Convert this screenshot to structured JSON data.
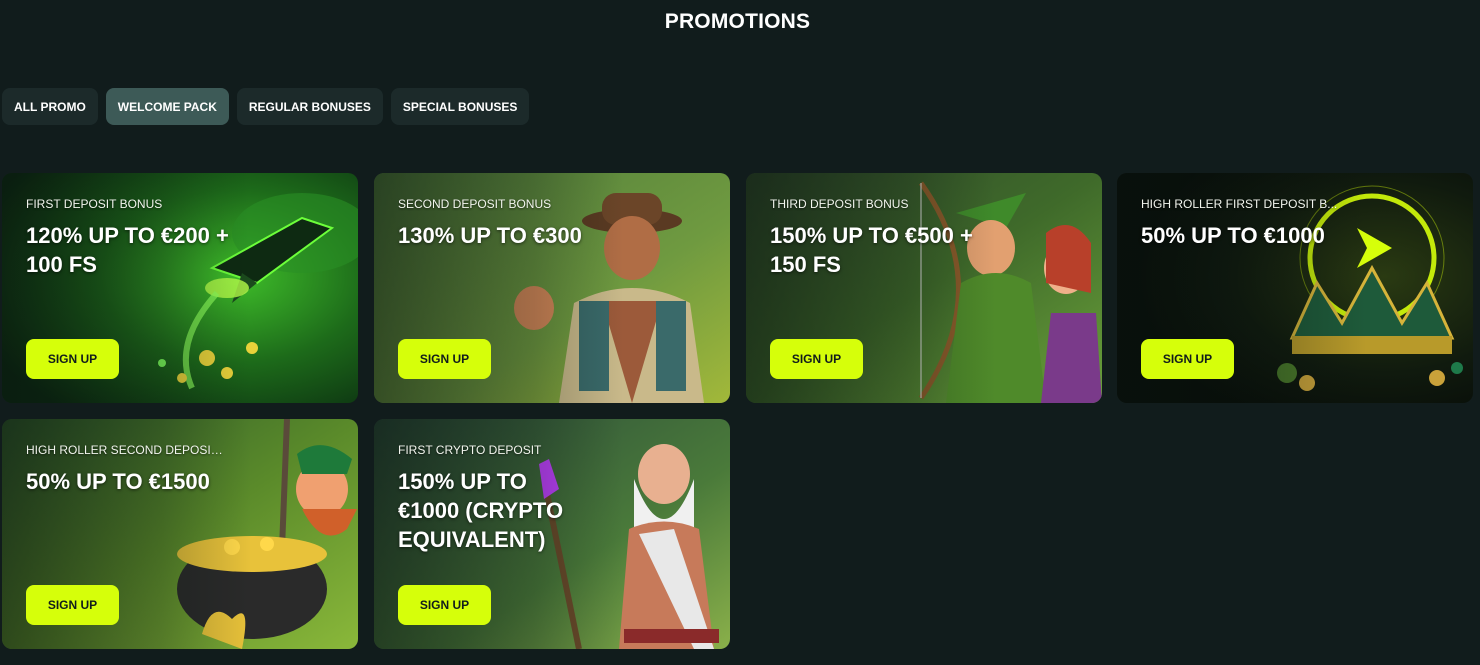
{
  "page": {
    "title": "PROMOTIONS"
  },
  "tabs": [
    {
      "label": "ALL PROMO",
      "active": false
    },
    {
      "label": "WELCOME PACK",
      "active": true
    },
    {
      "label": "REGULAR BONUSES",
      "active": false
    },
    {
      "label": "SPECIAL BONUSES",
      "active": false
    }
  ],
  "colors": {
    "background": "#111c1c",
    "tab": "#1c2a2a",
    "tab_active": "#3d5a57",
    "cta": "#d6ff0a",
    "cta_text": "#111c1c"
  },
  "promos": [
    {
      "label": "FIRST DEPOSIT BONUS",
      "offer": "120% UP TO €200 + 100 FS",
      "button": "SIGN UP",
      "art": "green-rocket-coins-art"
    },
    {
      "label": "SECOND DEPOSIT BONUS",
      "offer": "130% UP TO €300",
      "button": "SIGN UP",
      "art": "adventurer-cowboy-art"
    },
    {
      "label": "THIRD DEPOSIT BONUS",
      "offer": "150% UP TO €500 + 150 FS",
      "button": "SIGN UP",
      "art": "archer-hero-art"
    },
    {
      "label": "HIGH ROLLER FIRST DEPOSIT B...",
      "offer": "50% UP TO €1000",
      "button": "SIGN UP",
      "art": "neon-crown-art"
    },
    {
      "label": "HIGH ROLLER SECOND DEPOSIT...",
      "offer": "50% UP TO €1500",
      "button": "SIGN UP",
      "art": "leprechaun-gold-pot-art"
    },
    {
      "label": "FIRST CRYPTO DEPOSIT",
      "offer": "150% UP TO €1000 (CRYPTO EQUIVALENT)",
      "button": "SIGN UP",
      "art": "wizard-staff-art"
    }
  ]
}
